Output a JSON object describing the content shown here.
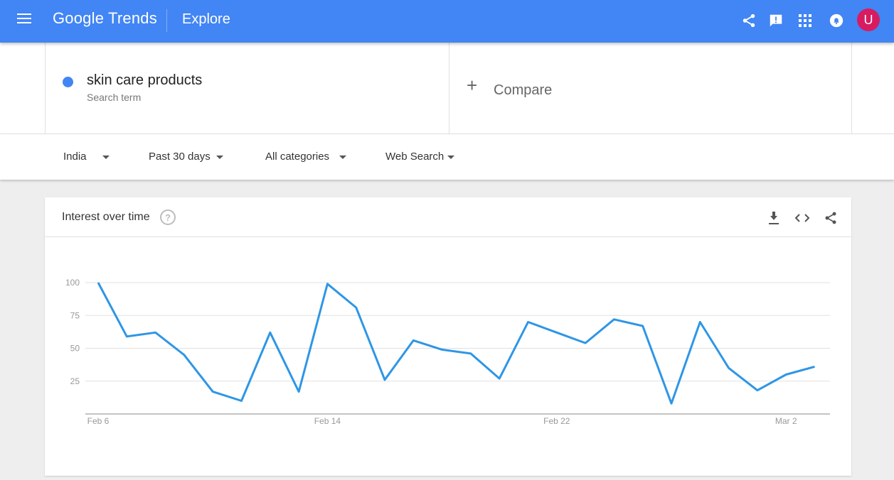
{
  "header": {
    "logo": "Google Trends",
    "section": "Explore",
    "avatar_letter": "U"
  },
  "terms": {
    "items": [
      {
        "label": "skin care products",
        "sub": "Search term",
        "color": "#4285f4"
      }
    ],
    "compare_label": "Compare"
  },
  "filters": {
    "region": "India",
    "time": "Past 30 days",
    "category": "All categories",
    "search_type": "Web Search"
  },
  "card": {
    "title": "Interest over time",
    "help_icon": "question-icon"
  },
  "chart_data": {
    "type": "line",
    "x": [
      "Feb 6",
      "Feb 7",
      "Feb 8",
      "Feb 9",
      "Feb 10",
      "Feb 11",
      "Feb 12",
      "Feb 13",
      "Feb 14",
      "Feb 15",
      "Feb 16",
      "Feb 17",
      "Feb 18",
      "Feb 19",
      "Feb 20",
      "Feb 21",
      "Feb 22",
      "Feb 23",
      "Feb 24",
      "Feb 25",
      "Feb 26",
      "Feb 27",
      "Feb 28",
      "Mar 1",
      "Mar 2",
      "Mar 3"
    ],
    "x_ticks": [
      "Feb 6",
      "Feb 14",
      "Feb 22",
      "Mar 2"
    ],
    "series": [
      {
        "name": "skin care products",
        "values": [
          100,
          59,
          62,
          45,
          17,
          10,
          62,
          17,
          99,
          81,
          26,
          56,
          49,
          46,
          27,
          70,
          62,
          54,
          72,
          67,
          8,
          70,
          35,
          18,
          30,
          36
        ]
      }
    ],
    "ylim": [
      0,
      100
    ],
    "y_ticks": [
      25,
      50,
      75,
      100
    ],
    "grid": true,
    "color": "#2e96e6"
  }
}
